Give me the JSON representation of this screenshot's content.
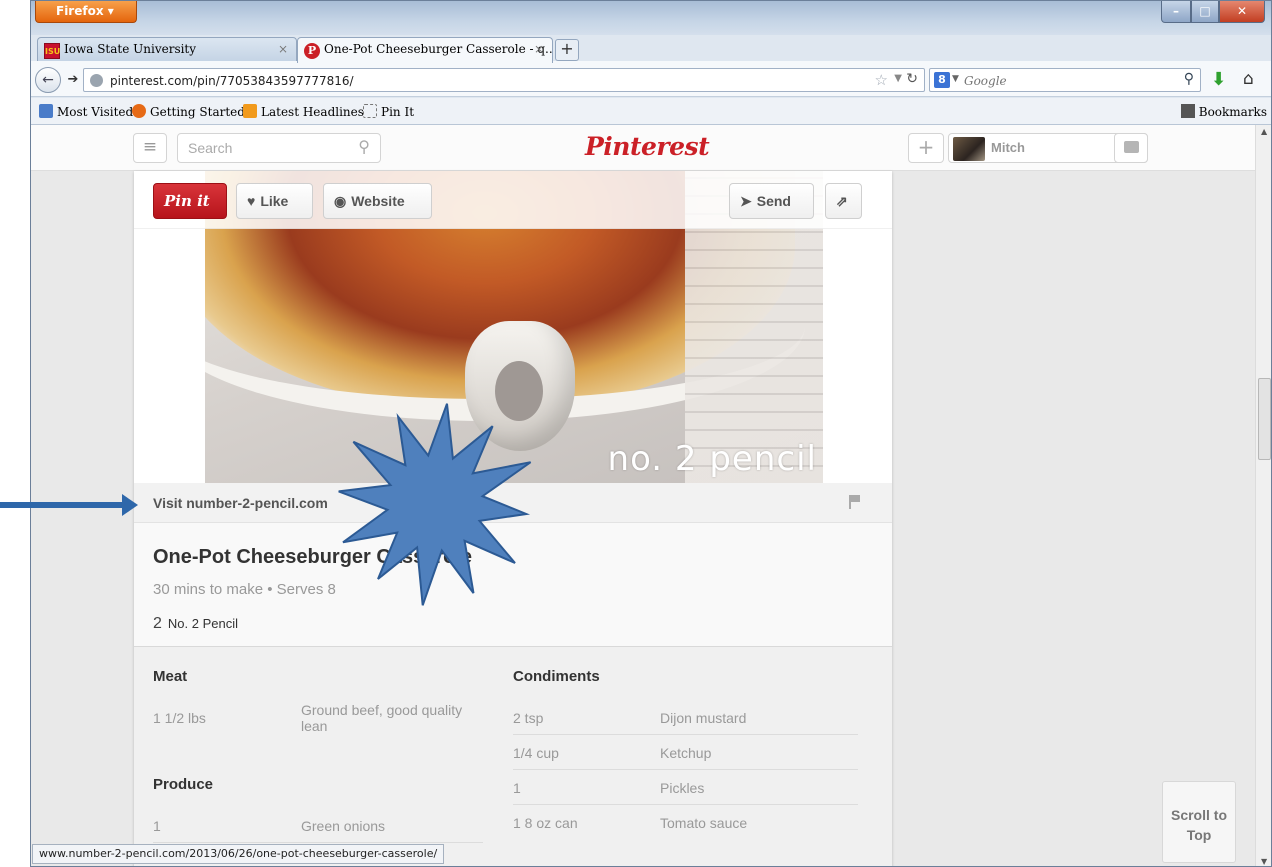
{
  "browser": {
    "app_button": "Firefox",
    "tabs": [
      {
        "label": "Iowa State University",
        "icon": "isu-icon",
        "icon_text": "ISU",
        "active": false
      },
      {
        "label": "One-Pot Cheeseburger Casserole - q...",
        "icon": "pinterest-icon",
        "icon_text": "P",
        "active": true
      }
    ],
    "new_tab_label": "+",
    "url": "pinterest.com/pin/77053843597777816/",
    "search_placeholder": "Google",
    "search_engine_icon_text": "8",
    "bookmarks": [
      {
        "label": "Most Visited",
        "icon": "most-visited-icon"
      },
      {
        "label": "Getting Started",
        "icon": "firefox-icon"
      },
      {
        "label": "Latest Headlines",
        "icon": "rss-icon"
      },
      {
        "label": "Pin It",
        "icon": "pin-it-icon"
      }
    ],
    "bookmarks_menu": "Bookmarks",
    "status_url": "www.number-2-pencil.com/2013/06/26/one-pot-cheeseburger-casserole/"
  },
  "pinterest": {
    "search_placeholder": "Search",
    "logo": "Pinterest",
    "username": "Mitch",
    "actions": {
      "pin_it": "Pin it",
      "like": "Like",
      "website": "Website",
      "send": "Send"
    },
    "image_watermark": "no. 2 pencil",
    "source_link": "Visit number-2-pencil.com",
    "pin_title": "One-Pot Cheeseburger Casserole",
    "pin_meta": "30 mins to make • Serves 8",
    "repin_count": "2",
    "board_name": "No. 2 Pencil",
    "recipe": {
      "left": [
        {
          "heading": "Meat",
          "items": [
            {
              "qty": "1 1/2 lbs",
              "name": "Ground beef, good quality lean"
            }
          ]
        },
        {
          "heading": "Produce",
          "items": [
            {
              "qty": "1",
              "name": "Green onions"
            }
          ]
        }
      ],
      "right": [
        {
          "heading": "Condiments",
          "items": [
            {
              "qty": "2 tsp",
              "name": "Dijon mustard"
            },
            {
              "qty": "1/4 cup",
              "name": "Ketchup"
            },
            {
              "qty": "1",
              "name": "Pickles"
            },
            {
              "qty": "1 8 oz can",
              "name": "Tomato sauce"
            }
          ]
        }
      ]
    },
    "scroll_to_top": "Scroll to Top"
  },
  "annotation": {
    "colors": {
      "arrow": "#2e67aa",
      "starburst_fill": "#4f80bd",
      "starburst_stroke": "#2c5a94"
    }
  }
}
